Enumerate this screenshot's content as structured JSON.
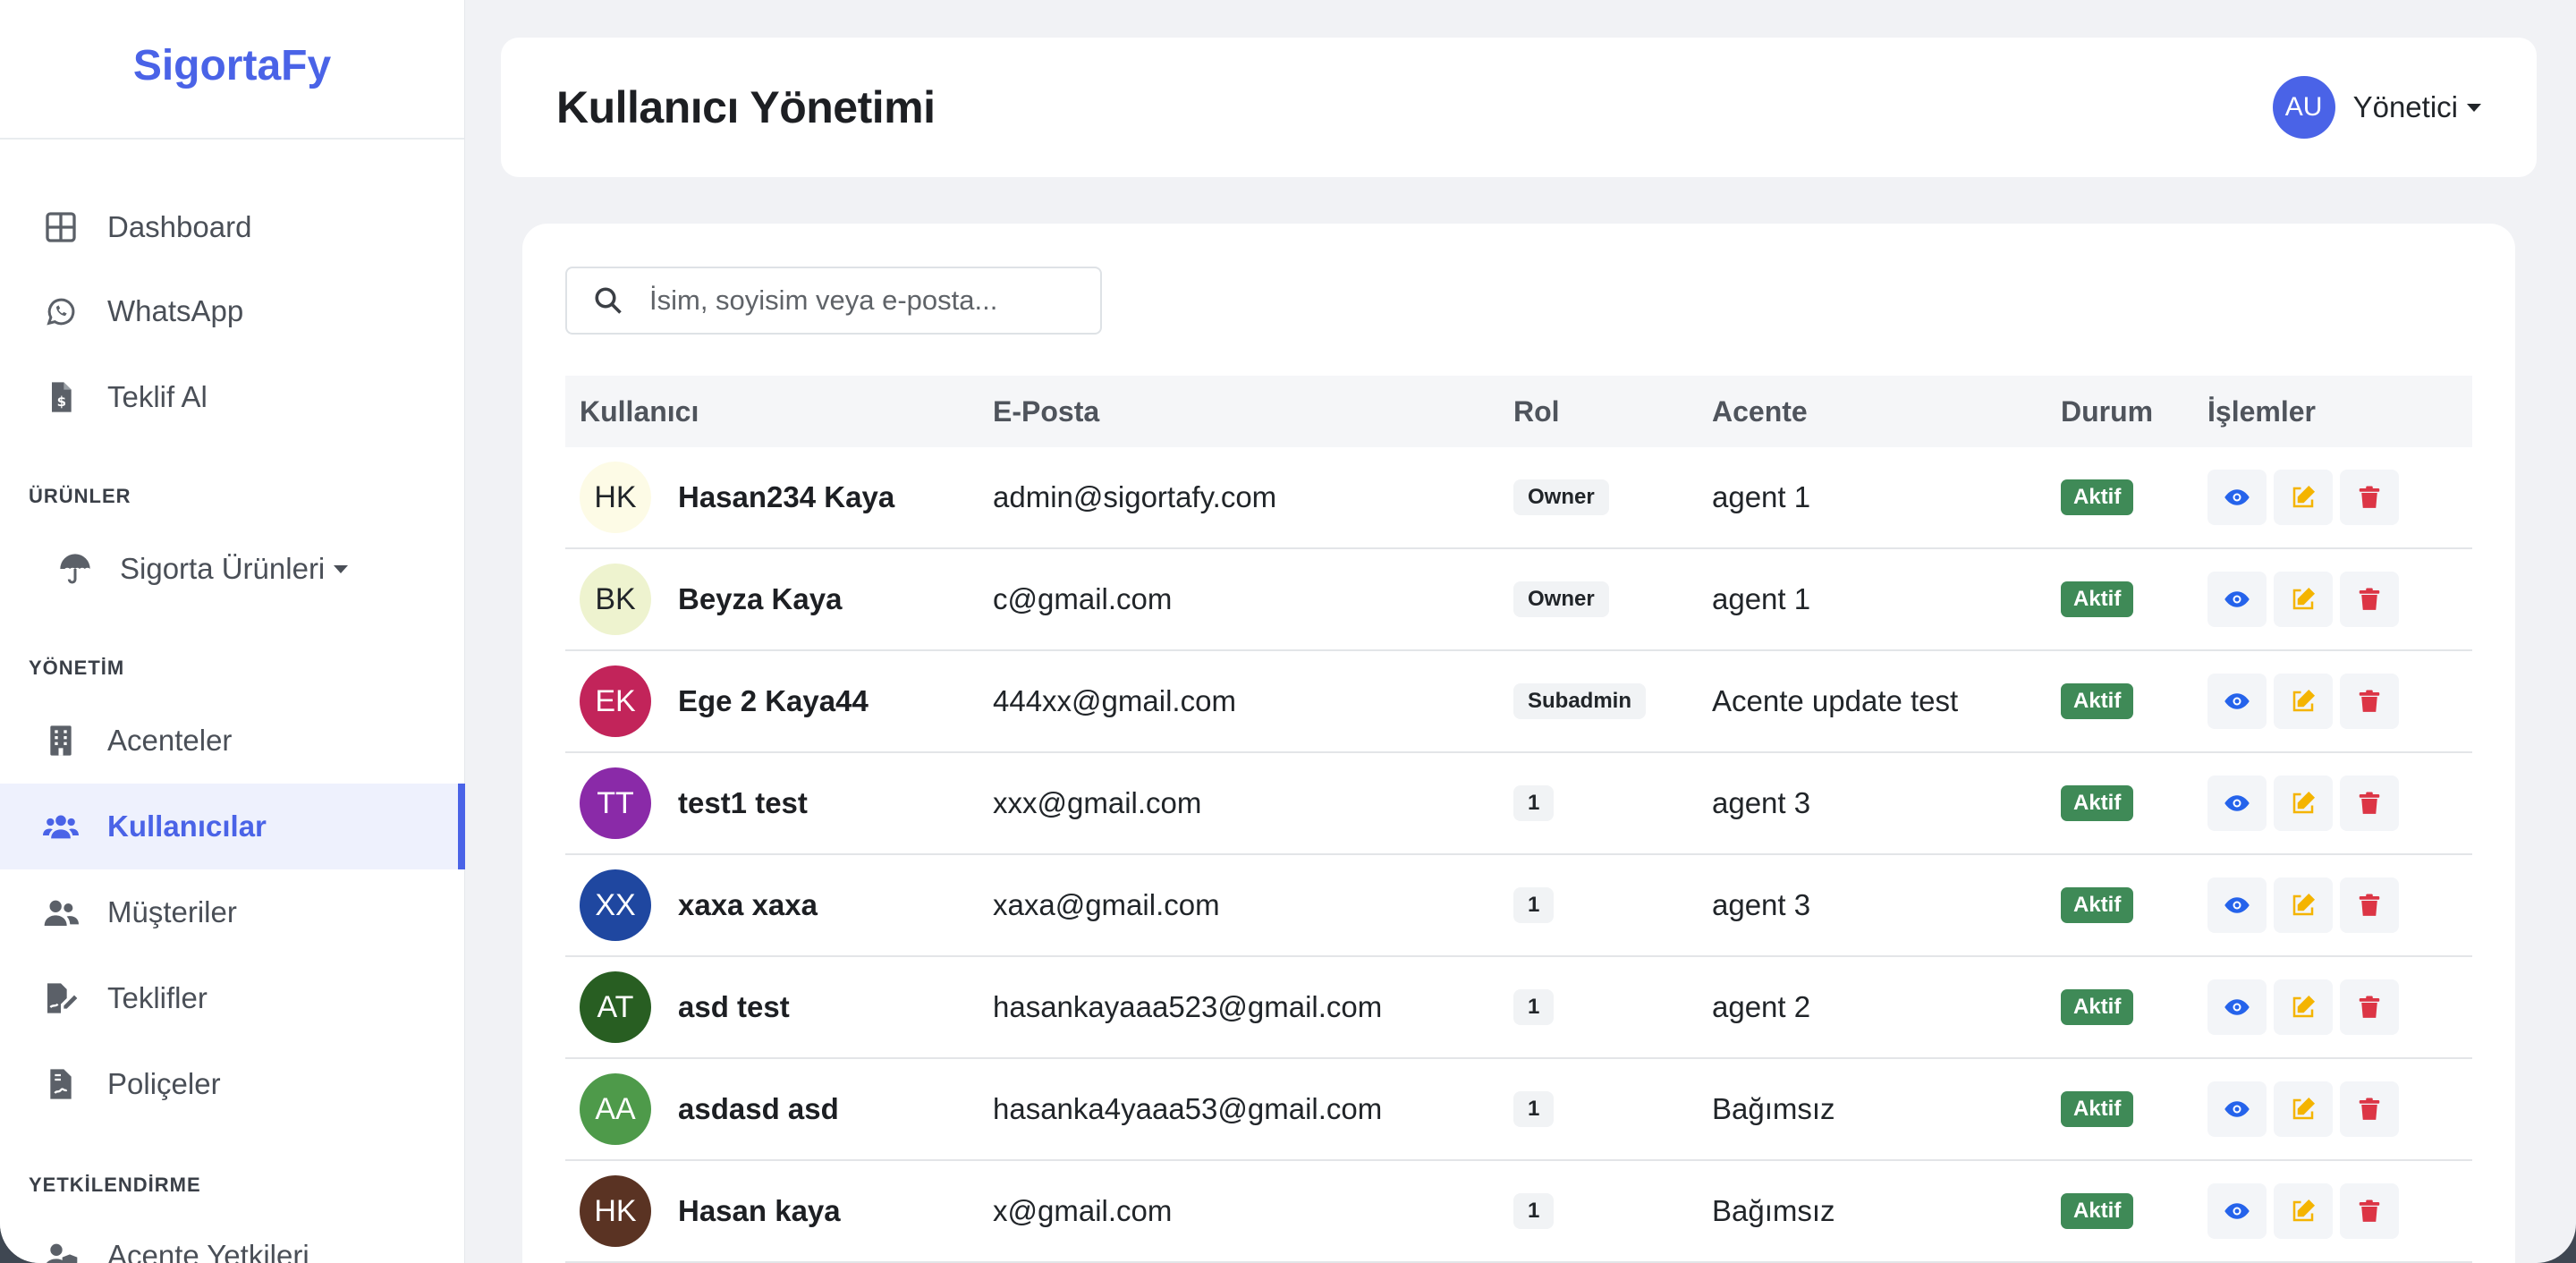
{
  "brand": "SigortaFy",
  "sidebar": {
    "items": [
      {
        "label": "Dashboard",
        "icon": "grid-icon"
      },
      {
        "label": "WhatsApp",
        "icon": "whatsapp-icon"
      },
      {
        "label": "Teklif Al",
        "icon": "file-invoice-dollar-icon"
      }
    ],
    "section_products": "ÜRÜNLER",
    "products_dropdown": "Sigorta Ürünleri",
    "section_management": "YÖNETİM",
    "management_items": [
      {
        "label": "Acenteler",
        "icon": "building-icon"
      },
      {
        "label": "Kullanıcılar",
        "icon": "users-icon",
        "active": true
      },
      {
        "label": "Müşteriler",
        "icon": "user-friends-icon"
      },
      {
        "label": "Teklifler",
        "icon": "file-signature-icon"
      },
      {
        "label": "Poliçeler",
        "icon": "file-contract-icon"
      }
    ],
    "section_auth": "YETKİLENDİRME",
    "auth_items": [
      {
        "label": "Acente Yetkileri",
        "icon": "user-shield-icon"
      }
    ]
  },
  "header": {
    "title": "Kullanıcı Yönetimi",
    "user_initials": "AU",
    "user_name": "Yönetici"
  },
  "search": {
    "placeholder": "İsim, soyisim veya e-posta..."
  },
  "table": {
    "columns": [
      "Kullanıcı",
      "E-Posta",
      "Rol",
      "Acente",
      "Durum",
      "İşlemler"
    ],
    "rows": [
      {
        "initials": "HK",
        "name": "Hasan234 Kaya",
        "email": "admin@sigortafy.com",
        "role": "Owner",
        "agency": "agent 1",
        "status": "Aktif",
        "avatar_bg": "#fdfbe6",
        "avatar_fg": "#212529"
      },
      {
        "initials": "BK",
        "name": "Beyza Kaya",
        "email": "c@gmail.com",
        "role": "Owner",
        "agency": "agent 1",
        "status": "Aktif",
        "avatar_bg": "#eef3cf",
        "avatar_fg": "#212529"
      },
      {
        "initials": "EK",
        "name": "Ege 2 Kaya44",
        "email": "444xx@gmail.com",
        "role": "Subadmin",
        "agency": "Acente update test",
        "status": "Aktif",
        "avatar_bg": "#c2245a",
        "avatar_fg": "#ffffff"
      },
      {
        "initials": "TT",
        "name": "test1 test",
        "email": "xxx@gmail.com",
        "role": "1",
        "agency": "agent 3",
        "status": "Aktif",
        "avatar_bg": "#8a2aa8",
        "avatar_fg": "#ffffff"
      },
      {
        "initials": "XX",
        "name": "xaxa xaxa",
        "email": "xaxa@gmail.com",
        "role": "1",
        "agency": "agent 3",
        "status": "Aktif",
        "avatar_bg": "#1f47a0",
        "avatar_fg": "#ffffff"
      },
      {
        "initials": "AT",
        "name": "asd test",
        "email": "hasankayaaa523@gmail.com",
        "role": "1",
        "agency": "agent 2",
        "status": "Aktif",
        "avatar_bg": "#285e22",
        "avatar_fg": "#ffffff"
      },
      {
        "initials": "AA",
        "name": "asdasd asd",
        "email": "hasanka4yaaa53@gmail.com",
        "role": "1",
        "agency": "Bağımsız",
        "status": "Aktif",
        "avatar_bg": "#4e9a4a",
        "avatar_fg": "#ffffff"
      },
      {
        "initials": "HK",
        "name": "Hasan kaya",
        "email": "x@gmail.com",
        "role": "1",
        "agency": "Bağımsız",
        "status": "Aktif",
        "avatar_bg": "#5a3323",
        "avatar_fg": "#ffffff"
      }
    ]
  },
  "colors": {
    "accent": "#4a63e7",
    "status_active": "#3f8a57",
    "view_action": "#2563eb",
    "edit_action": "#f4b400",
    "delete_action": "#dc3545"
  }
}
